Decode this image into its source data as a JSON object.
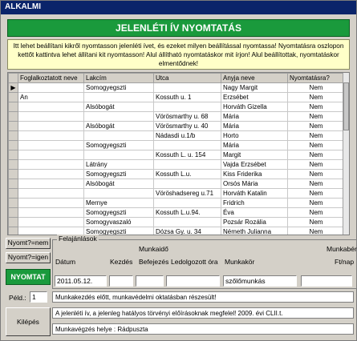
{
  "window": {
    "title": "ALKALMI"
  },
  "banner": {
    "text": "JELENLÉTI ÍV NYOMTATÁS"
  },
  "info": {
    "text": "Itt lehet beállítani kikről nyomtasson jelenléti ívet, és ezeket milyen beállítással nyomtassa! Nyomtatásra oszlopon kettőt kattintva lehet állítani kit nyomtasson! Alul állítható nyomtatáskor mit írjon! Alul beállítottak, nyomtatáskor elmentődnek!"
  },
  "grid": {
    "columns": [
      "",
      "Foglalkoztatott neve",
      "Lakcím",
      "Utca",
      "Anyja neve",
      "Nyomtatásra?"
    ],
    "rows": [
      {
        "name": "",
        "city": "Somogyegszti",
        "street": "",
        "mother": "Nagy Margit",
        "print": "Nem"
      },
      {
        "name": "An",
        "city": "",
        "street": "Kossuth u. 1",
        "mother": "Erzsébet",
        "print": "Nem"
      },
      {
        "name": "",
        "city": "Alsóbogát",
        "street": "",
        "mother": "Horváth Gizella",
        "print": "Nem"
      },
      {
        "name": "",
        "city": "",
        "street": "Vörösmarthy u. 68",
        "mother": "Mária",
        "print": "Nem"
      },
      {
        "name": "",
        "city": "Alsóbogát",
        "street": "Vörösmarthy u. 40",
        "mother": "Mária",
        "print": "Nem"
      },
      {
        "name": "",
        "city": "",
        "street": "Nádasdi u.1/b",
        "mother": "Horto",
        "print": "Nem"
      },
      {
        "name": "",
        "city": "Somogyegszti",
        "street": "",
        "mother": "Mária",
        "print": "Nem"
      },
      {
        "name": "",
        "city": "",
        "street": "Kossuth L. u. 154",
        "mother": "Margit",
        "print": "Nem"
      },
      {
        "name": "",
        "city": "Látrány",
        "street": "",
        "mother": "Vajda Erzsébet",
        "print": "Nem"
      },
      {
        "name": "",
        "city": "Somogyegszti",
        "street": "Kossuth L.u.",
        "mother": "Kiss Friderika",
        "print": "Nem"
      },
      {
        "name": "",
        "city": "Alsóbogát",
        "street": "",
        "mother": "Orsós Mária",
        "print": "Nem"
      },
      {
        "name": "",
        "city": "",
        "street": "Vöröshadsereg u.71",
        "mother": "Horváth Katalin",
        "print": "Nem"
      },
      {
        "name": "",
        "city": "Mernye",
        "street": "",
        "mother": "Fridrich",
        "print": "Nem"
      },
      {
        "name": "",
        "city": "Somogyegszti",
        "street": "Kossuth L.u.94.",
        "mother": "Éva",
        "print": "Nem"
      },
      {
        "name": "",
        "city": "Somogyvaszaló",
        "street": "",
        "mother": "Pozsár Rozália",
        "print": "Nem"
      },
      {
        "name": "",
        "city": "Somogyegszti",
        "street": "Dózsa Gy. u. 34",
        "mother": "Németh Julianna",
        "print": "Nem"
      }
    ]
  },
  "side": {
    "print_no": "Nyomt?=nem",
    "print_yes": "Nyomt?=igen",
    "print": "NYOMTAT",
    "peld_label": "Péld.:",
    "peld_value": "1",
    "exit": "Kilépés"
  },
  "offers": {
    "legend": "Felajánlások",
    "munkaido": "Munkaidő",
    "datum": "Dátum",
    "kezdes": "Kezdés",
    "befejezes": "Befejezés",
    "ledolgozott": "Ledolgozott óra",
    "munkakor": "Munkakör",
    "munkaber": "Munkabér",
    "ftnap": "Ft/nap",
    "datum_value": "2011.05.12.",
    "munkakor_value": "szőlőmunkás"
  },
  "notes": {
    "line1": "Munkakezdés előtt, munkavédelmi oktatásban részesült!",
    "line2": "A jelenléti ív, a jelenleg hatályos törvényi előírásoknak megfelel! 2009. évi CLII.t.",
    "line3": "Munkavégzés helye : Rádpuszta"
  }
}
